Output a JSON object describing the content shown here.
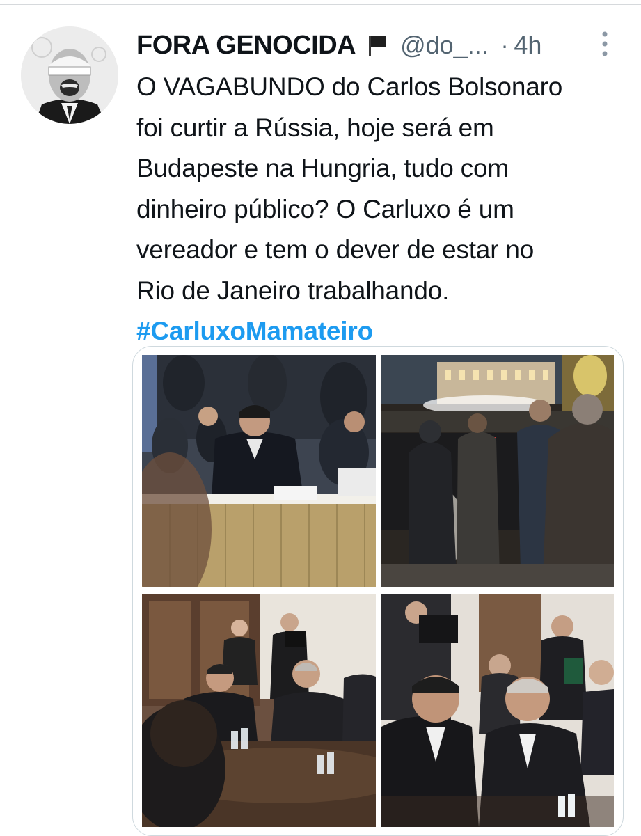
{
  "tweet": {
    "display_name": "FORA GENOCIDA",
    "flag_icon": "black-flag-icon",
    "handle": "@do_...",
    "dot": "·",
    "time": "4h",
    "text_lines": [
      "O VAGABUNDO do Carlos Bolsonaro",
      "foi curtir a Rússia, hoje será em",
      "Budapeste na Hungria, tudo com",
      "dinheiro público? O Carluxo é um",
      "vereador e tem o dever de estar no",
      "Rio de Janeiro trabalhando."
    ],
    "hashtag": "#CarluxoMamateiro",
    "hashtag_color": "#1d9bf0",
    "name_color": "#0f1419",
    "meta_color": "#536471"
  },
  "media": {
    "photos": [
      {
        "name": "conference-table-photo"
      },
      {
        "name": "night-street-photo"
      },
      {
        "name": "meeting-room-photo"
      },
      {
        "name": "meeting-closeup-photo"
      }
    ]
  }
}
